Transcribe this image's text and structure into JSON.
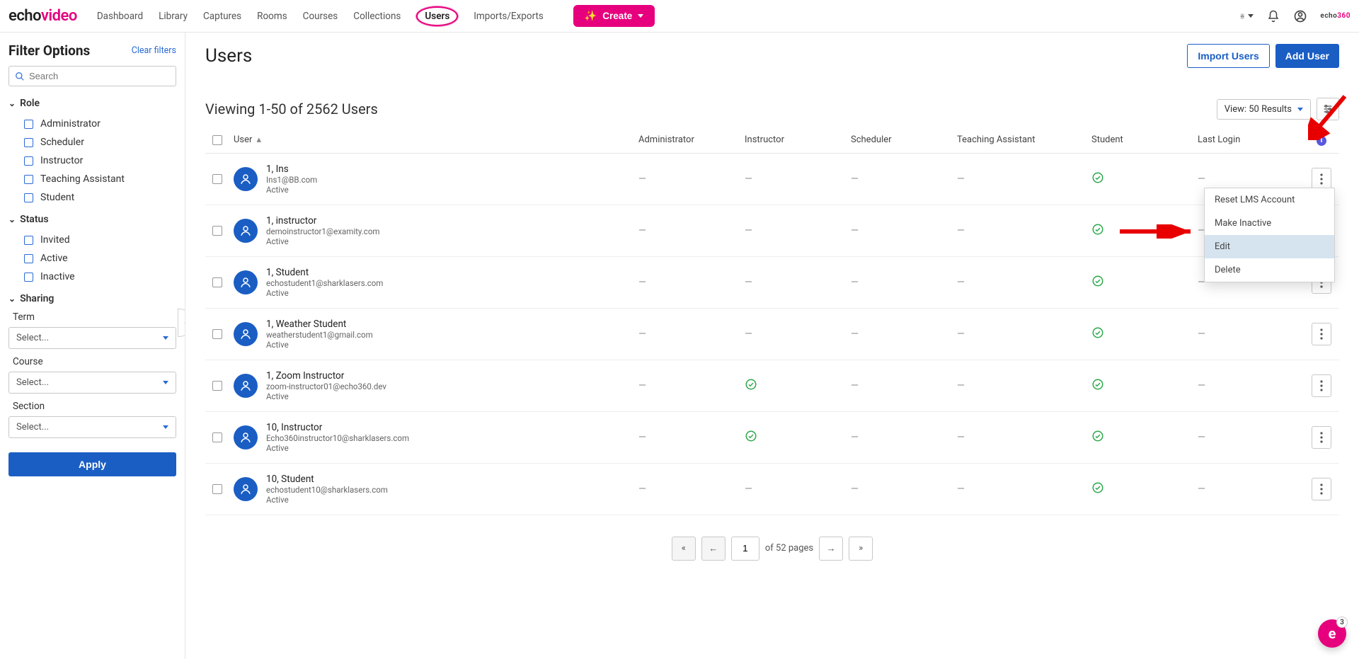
{
  "brand": {
    "echo": "echo",
    "video": "video",
    "small": {
      "a": "echo",
      "b": "360"
    }
  },
  "nav": {
    "items": [
      "Dashboard",
      "Library",
      "Captures",
      "Rooms",
      "Courses",
      "Collections",
      "Users",
      "Imports/Exports"
    ],
    "active_index": 6,
    "create_label": "Create"
  },
  "sidebar": {
    "title": "Filter Options",
    "clear": "Clear filters",
    "search_placeholder": "Search",
    "sections": {
      "role": {
        "label": "Role",
        "items": [
          "Administrator",
          "Scheduler",
          "Instructor",
          "Teaching Assistant",
          "Student"
        ]
      },
      "status": {
        "label": "Status",
        "items": [
          "Invited",
          "Active",
          "Inactive"
        ]
      },
      "sharing": {
        "label": "Sharing",
        "term_label": "Term",
        "term_placeholder": "Select...",
        "course_label": "Course",
        "course_placeholder": "Select...",
        "section_label": "Section",
        "section_placeholder": "Select..."
      }
    },
    "apply": "Apply"
  },
  "page": {
    "title": "Users",
    "import": "Import Users",
    "add": "Add User",
    "subtitle": "Viewing 1-50 of 2562 Users",
    "view_label": "View: 50 Results"
  },
  "table": {
    "headers": [
      "User",
      "Administrator",
      "Instructor",
      "Scheduler",
      "Teaching Assistant",
      "Student",
      "Last Login"
    ],
    "rows": [
      {
        "name": "1, Ins",
        "email": "Ins1@BB.com",
        "status": "Active",
        "admin": "—",
        "instructor": "—",
        "scheduler": "—",
        "ta": "—",
        "student": "check",
        "last": "—",
        "menu_open": true
      },
      {
        "name": "1, instructor",
        "email": "demoinstructor1@examity.com",
        "status": "Active",
        "admin": "—",
        "instructor": "—",
        "scheduler": "—",
        "ta": "—",
        "student": "check",
        "last": "—"
      },
      {
        "name": "1, Student",
        "email": "echostudent1@sharklasers.com",
        "status": "Active",
        "admin": "—",
        "instructor": "—",
        "scheduler": "—",
        "ta": "—",
        "student": "check",
        "last": "—"
      },
      {
        "name": "1, Weather Student",
        "email": "weatherstudent1@gmail.com",
        "status": "Active",
        "admin": "—",
        "instructor": "—",
        "scheduler": "—",
        "ta": "—",
        "student": "check",
        "last": "—"
      },
      {
        "name": "1, Zoom Instructor",
        "email": "zoom-instructor01@echo360.dev",
        "status": "Active",
        "admin": "—",
        "instructor": "check",
        "scheduler": "—",
        "ta": "—",
        "student": "check",
        "last": "—"
      },
      {
        "name": "10, Instructor",
        "email": "Echo360instructor10@sharklasers.com",
        "status": "Active",
        "admin": "—",
        "instructor": "check",
        "scheduler": "—",
        "ta": "—",
        "student": "check",
        "last": "—"
      },
      {
        "name": "10, Student",
        "email": "echostudent10@sharklasers.com",
        "status": "Active",
        "admin": "—",
        "instructor": "—",
        "scheduler": "—",
        "ta": "—",
        "student": "check",
        "last": "—"
      }
    ],
    "context_menu": [
      "Reset LMS Account",
      "Make Inactive",
      "Edit",
      "Delete"
    ],
    "context_hovered_index": 2
  },
  "pager": {
    "current": "1",
    "of": "of 52 pages"
  },
  "badge": {
    "letter": "e",
    "count": "3"
  }
}
